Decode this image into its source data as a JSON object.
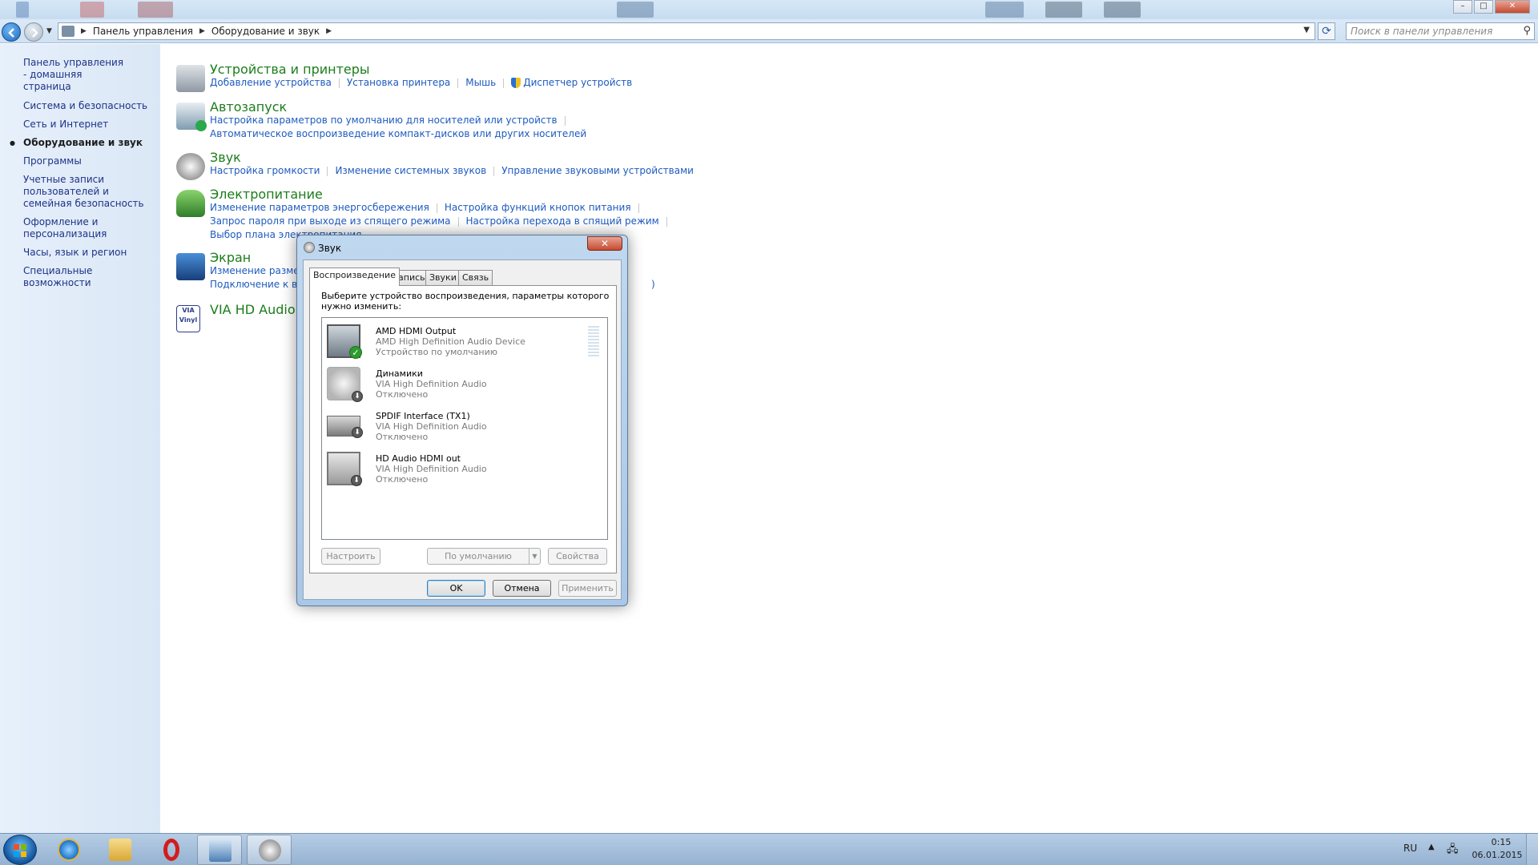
{
  "address_bar": {
    "crumbs": [
      "Панель управления",
      "Оборудование и звук"
    ],
    "search_placeholder": "Поиск в панели управления"
  },
  "window_controls": {
    "minimize": "–",
    "maximize": "□",
    "close": "✕"
  },
  "sidebar": {
    "items": [
      {
        "label": "Панель управления - домашняя страница",
        "active": false
      },
      {
        "label": "Система и безопасность",
        "active": false
      },
      {
        "label": "Сеть и Интернет",
        "active": false
      },
      {
        "label": "Оборудование и звук",
        "active": true
      },
      {
        "label": "Программы",
        "active": false
      },
      {
        "label": "Учетные записи пользователей и семейная безопасность",
        "active": false
      },
      {
        "label": "Оформление и персонализация",
        "active": false
      },
      {
        "label": "Часы, язык и регион",
        "active": false
      },
      {
        "label": "Специальные возможности",
        "active": false
      }
    ]
  },
  "categories": {
    "devices": {
      "icon": "printer-icon",
      "title": "Устройства и принтеры",
      "links": [
        "Добавление устройства",
        "Установка принтера",
        "Мышь",
        "Диспетчер устройств"
      ]
    },
    "autoplay": {
      "icon": "autoplay-icon",
      "title": "Автозапуск",
      "links": [
        "Настройка параметров по умолчанию для носителей или устройств",
        "Автоматическое воспроизведение компакт-дисков или других носителей"
      ]
    },
    "sound": {
      "icon": "speaker-icon",
      "title": "Звук",
      "links": [
        "Настройка громкости",
        "Изменение системных звуков",
        "Управление звуковыми устройствами"
      ]
    },
    "power": {
      "icon": "power-options-icon",
      "title": "Электропитание",
      "links": [
        "Изменение параметров энергосбережения",
        "Настройка функций кнопок питания",
        "Запрос пароля при выходе из спящего режима",
        "Настройка перехода в спящий режим",
        "Выбор плана электропитания"
      ]
    },
    "display": {
      "icon": "monitor-icon",
      "title": "Экран",
      "links": [
        "Изменение размер",
        "Подключение к вне",
        ")"
      ]
    },
    "via": {
      "icon": "via-vinyl-icon",
      "title": "VIA HD Audio D"
    }
  },
  "dialog": {
    "title": "Звук",
    "close": "✕",
    "tabs": [
      "Воспроизведение",
      "Запись",
      "Звуки",
      "Связь"
    ],
    "selected_tab": 0,
    "instruction": "Выберите устройство воспроизведения, параметры которого нужно изменить:",
    "devices": [
      {
        "name": "AMD HDMI Output",
        "driver": "AMD High Definition Audio Device",
        "status": "Устройство по умолчанию",
        "icon": "monitor-icon",
        "badge": "check-icon"
      },
      {
        "name": "Динамики",
        "driver": "VIA High Definition Audio",
        "status": "Отключено",
        "icon": "speaker-icon",
        "badge": "disabled-arrow-icon"
      },
      {
        "name": "SPDIF Interface (TX1)",
        "driver": "VIA High Definition Audio",
        "status": "Отключено",
        "icon": "receiver-icon",
        "badge": "disabled-arrow-icon"
      },
      {
        "name": "HD Audio HDMI out",
        "driver": "VIA High Definition Audio",
        "status": "Отключено",
        "icon": "monitor-icon",
        "badge": "disabled-arrow-icon"
      }
    ],
    "buttons": {
      "configure": "Настроить",
      "set_default": "По умолчанию",
      "properties": "Свойства",
      "ok": "OK",
      "cancel": "Отмена",
      "apply": "Применить"
    }
  },
  "taskbar": {
    "apps": [
      "ie-icon",
      "explorer-folder-icon",
      "opera-icon",
      "control-panel-icon",
      "sound-icon"
    ],
    "tray": {
      "lang": "RU",
      "arrow": "▲",
      "time": "0:15",
      "date": "06.01.2015"
    }
  }
}
